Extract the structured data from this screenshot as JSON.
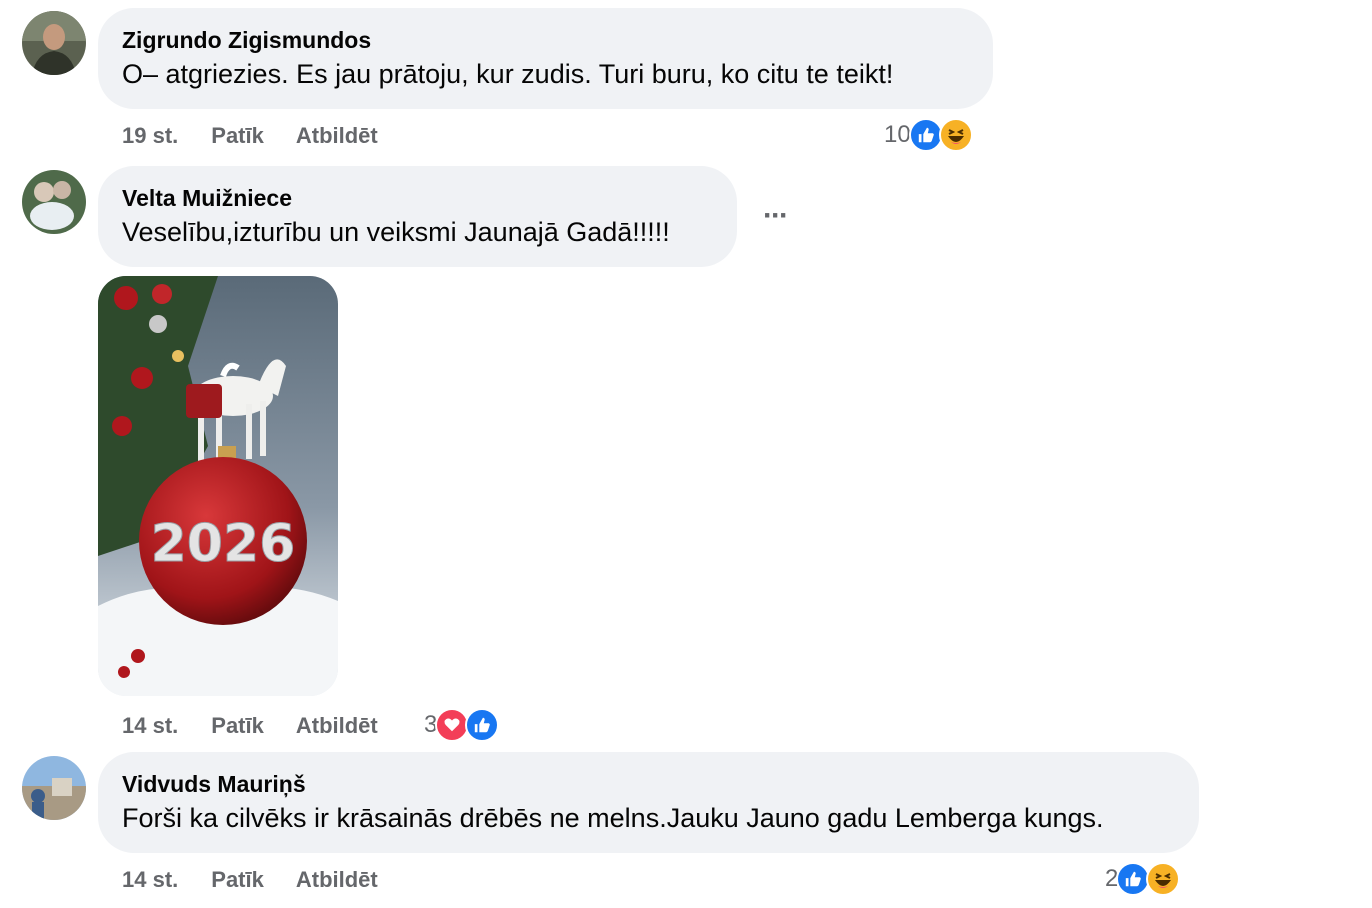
{
  "comments": [
    {
      "author": "Zigrundo Zigismundos",
      "text": "O– atgriezies. Es jau prātoju, kur zudis. Turi buru, ko citu te teikt!",
      "time": "19 st.",
      "like_label": "Patīk",
      "reply_label": "Atbildēt",
      "reaction_count": "10",
      "reactions": [
        "like-icon",
        "haha-icon"
      ]
    },
    {
      "author": "Velta Muižniece",
      "text": "Veselību,izturību un veiksmi Jaunajā Gadā!!!!!",
      "time": "14 st.",
      "like_label": "Patīk",
      "reply_label": "Atbildēt",
      "reaction_count": "3",
      "reactions": [
        "love-icon",
        "like-icon"
      ],
      "more_label": "···",
      "image_text": "2026"
    },
    {
      "author": "Vidvuds Mauriņš",
      "text": "Forši ka cilvēks ir krāsainās drēbēs ne melns.Jauku Jauno gadu Lemberga kungs.",
      "time": "14 st.",
      "like_label": "Patīk",
      "reply_label": "Atbildēt",
      "reaction_count": "2",
      "reactions": [
        "like-icon",
        "haha-icon"
      ]
    }
  ],
  "colors": {
    "bubble": "#f0f2f5",
    "meta_text": "#65676b",
    "like": "#1877f2",
    "love": "#f33e58",
    "haha": "#f7b125"
  }
}
